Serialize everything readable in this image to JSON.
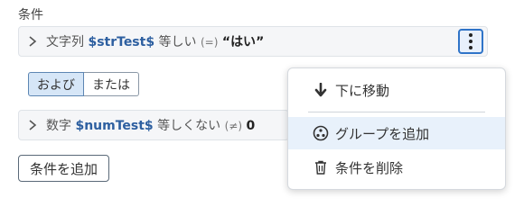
{
  "section": {
    "label": "条件"
  },
  "condition1": {
    "type": "文字列",
    "variable": "$strTest$",
    "operator": "等しい",
    "op_symbol": "(=)",
    "value_open": "“",
    "value": "はい",
    "value_close": "”"
  },
  "logic": {
    "and_label": "および",
    "or_label": "または",
    "selected": "および"
  },
  "condition2": {
    "type": "数字",
    "variable": "$numTest$",
    "operator": "等しくない",
    "op_symbol": "(≠)",
    "value": "0"
  },
  "add_condition_label": "条件を追加",
  "menu": {
    "items": [
      {
        "label": "下に移動",
        "icon": "arrow-down-icon"
      },
      {
        "label": "グループを追加",
        "icon": "group-add-icon"
      },
      {
        "label": "条件を削除",
        "icon": "trash-icon"
      }
    ]
  },
  "colors": {
    "accent": "#2f74c8",
    "variable": "#2d5fa0",
    "highlight": "#e8f1fb"
  }
}
